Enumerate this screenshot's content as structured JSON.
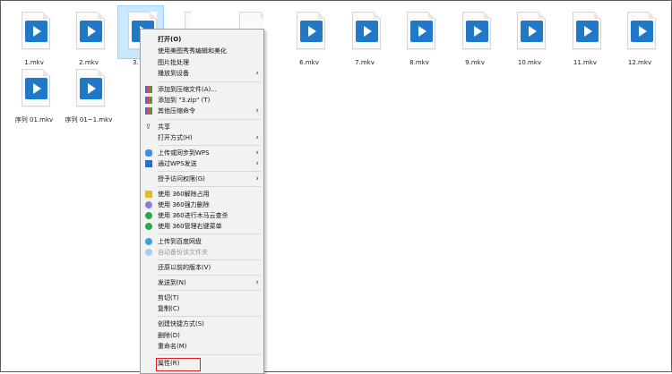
{
  "files": [
    {
      "name": "1.mkv"
    },
    {
      "name": "2.mkv"
    },
    {
      "name": "3."
    },
    {
      "name": ""
    },
    {
      "name": ""
    },
    {
      "name": "6.mkv"
    },
    {
      "name": "7.mkv"
    },
    {
      "name": "8.mkv"
    },
    {
      "name": "9.mkv"
    },
    {
      "name": "10.mkv"
    },
    {
      "name": "11.mkv"
    },
    {
      "name": "12.mkv"
    },
    {
      "name": "序列 01.mkv"
    },
    {
      "name": "序列 01~1.mkv"
    }
  ],
  "menu": {
    "open": "打开(O)",
    "meitu": "使用美图秀秀编辑和美化",
    "batch": "图片批处理",
    "cast": "播放到设备",
    "add_archive": "添加到压缩文件(A)...",
    "add_zip": "添加到 \"3.zip\" (T)",
    "other_compress": "其他压缩命令",
    "share": "共享",
    "open_with": "打开方式(H)",
    "upload_wps": "上传或同步到WPS",
    "send_wps": "通过WPS发送",
    "grant_access": "授予访问权限(G)",
    "unlock_360": "使用 360解除占用",
    "shred_360": "使用 360强力删除",
    "scan_360": "使用 360进行木马云查杀",
    "manage_360": "使用 360管理右键菜单",
    "baidu_upload": "上传到百度网盘",
    "baidu_backup": "自动备份该文件夹",
    "restore": "还原以前的版本(V)",
    "send_to": "发送到(N)",
    "cut": "剪切(T)",
    "copy": "复制(C)",
    "shortcut": "创建快捷方式(S)",
    "delete": "删除(D)",
    "rename": "重命名(M)",
    "properties": "属性(R)"
  },
  "colors": {
    "video_icon": "#1f78c8",
    "highlight": "#e02020",
    "selection": "#cce8ff"
  }
}
